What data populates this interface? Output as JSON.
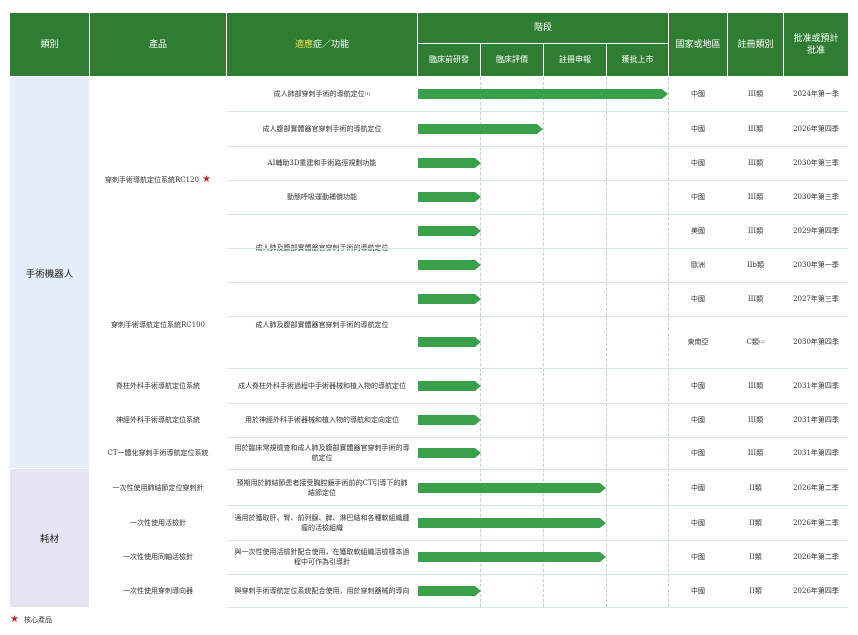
{
  "headers": {
    "category": "類別",
    "product": "產品",
    "indication_hl": "適應",
    "indication_rest": "症／功能",
    "stage": "階段",
    "stage_cols": [
      "臨床前研發",
      "臨床評價",
      "註冊申報",
      "獲批上市"
    ],
    "region": "國家或地區",
    "reg_class": "註冊類別",
    "approval": "批准或預計批准"
  },
  "categories": [
    {
      "label": "手術機器人"
    },
    {
      "label": "耗材"
    }
  ],
  "products": [
    {
      "label": "穿刺手術導航定位系統RC120",
      "core": true
    },
    {
      "label": "穿刺手術導航定位系統RC100"
    },
    {
      "label": "脊柱外科手術導航定位系統"
    },
    {
      "label": "神經外科手術導航定位系統"
    },
    {
      "label": "CT一體化穿刺手術導航定位系統"
    },
    {
      "label": "一次性使用肺結節定位穿刺針"
    },
    {
      "label": "一次性使用活檢針"
    },
    {
      "label": "一次性使用同軸活檢針"
    },
    {
      "label": "一次性使用穿刺導向器"
    }
  ],
  "indications": [
    {
      "label": "成人肺部穿刺手術的導航定位",
      "note": "(1)"
    },
    {
      "label": "成人腹部實體器官穿刺手術的導航定位"
    },
    {
      "label": "AI輔助3D重建和手術路徑規劃功能"
    },
    {
      "label": "動態呼吸運動補償功能"
    },
    {
      "label": "成人肺及腹部實體器官穿刺手術的導航定位"
    },
    {
      "label": "成人肺及腹部實體器官穿刺手術的導航定位"
    },
    {
      "label": "成人脊柱外科手術過程中手術器械和植入物的導航定位"
    },
    {
      "label": "用於神經外科手術器械和植入物的導航和定向定位"
    },
    {
      "label": "用於臨床常規檢查和成人肺及腹部實體器官穿刺手術的導航定位"
    },
    {
      "label": "預期用於肺結節患者接受胸腔鏡手術前的CT引導下的肺結節定位"
    },
    {
      "label": "適用於獲取肝、腎、前列腺、脾、淋巴結和各種軟組織腫瘤的活檢組織"
    },
    {
      "label": "與一次性使用活檢針配合使用，在獲取軟組織活檢樣本過程中可作為引導針"
    },
    {
      "label": "與穿刺手術導航定位系統配合使用，用於穿刺器械的導向"
    }
  ],
  "rows": [
    {
      "progress": 1.0,
      "region": "中國",
      "reg": "III類",
      "reg_note": "",
      "date": "2024年第一季"
    },
    {
      "progress": 0.5,
      "region": "中國",
      "reg": "III類",
      "reg_note": "",
      "date": "2026年第四季"
    },
    {
      "progress": 0.25,
      "region": "中國",
      "reg": "III類",
      "reg_note": "",
      "date": "2030年第三季"
    },
    {
      "progress": 0.25,
      "region": "中國",
      "reg": "III類",
      "reg_note": "",
      "date": "2030年第三季"
    },
    {
      "progress": 0.25,
      "region": "美國",
      "reg": "III類",
      "reg_note": "",
      "date": "2029年第四季"
    },
    {
      "progress": 0.25,
      "region": "歐洲",
      "reg": "IIb類",
      "reg_note": "",
      "date": "2030年第一季"
    },
    {
      "progress": 0.25,
      "region": "中國",
      "reg": "III類",
      "reg_note": "",
      "date": "2027年第三季"
    },
    {
      "progress": 0.25,
      "region": "東南亞",
      "reg": "C類",
      "reg_note": "(2)",
      "date": "2030年第四季"
    },
    {
      "progress": 0.25,
      "region": "中國",
      "reg": "III類",
      "reg_note": "",
      "date": "2031年第四季"
    },
    {
      "progress": 0.25,
      "region": "中國",
      "reg": "III類",
      "reg_note": "",
      "date": "2031年第四季"
    },
    {
      "progress": 0.25,
      "region": "中國",
      "reg": "III類",
      "reg_note": "",
      "date": "2031年第四季"
    },
    {
      "progress": 0.75,
      "region": "中國",
      "reg": "II類",
      "reg_note": "",
      "date": "2026年第二季"
    },
    {
      "progress": 0.75,
      "region": "中國",
      "reg": "II類",
      "reg_note": "",
      "date": "2026年第二季"
    },
    {
      "progress": 0.75,
      "region": "中國",
      "reg": "II類",
      "reg_note": "",
      "date": "2026年第二季"
    },
    {
      "progress": 0.25,
      "region": "中國",
      "reg": "II類",
      "reg_note": "",
      "date": "2026年第四季"
    }
  ],
  "footnote": "核心產品",
  "colors": {
    "header": "#2e7d32",
    "bar": "#3aa14a",
    "star": "#c62828",
    "cat_robot": "#e4eef8",
    "cat_consumable": "#e4e4f2"
  }
}
